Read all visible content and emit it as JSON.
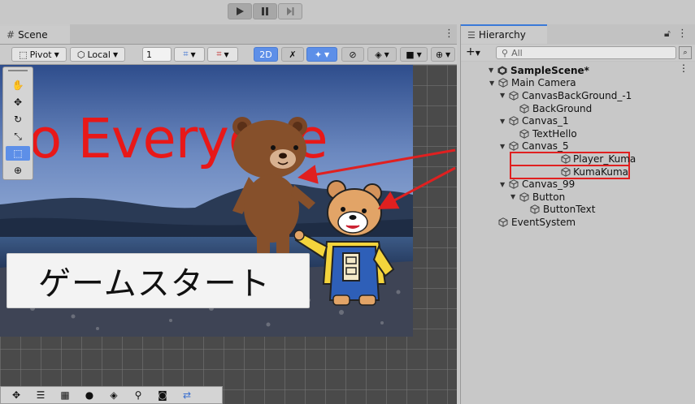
{
  "scene_tab": {
    "label": "Scene"
  },
  "scene_toolbar": {
    "pivot_label": "Pivot",
    "local_label": "Local",
    "grid_value": "1",
    "mode_2d": "2D"
  },
  "viewport": {
    "hello_text": "llo Everyone",
    "start_button_text": "ゲームスタート"
  },
  "hierarchy": {
    "tab_label": "Hierarchy",
    "search_placeholder": "All",
    "items": [
      {
        "label": "SampleScene*",
        "depth": 0,
        "expanded": true,
        "icon": "unity-scene-icon",
        "bold": true
      },
      {
        "label": "Main Camera",
        "depth": 1,
        "expanded": true,
        "icon": "gameobject-icon"
      },
      {
        "label": "CanvasBackGround_-1",
        "depth": 2,
        "expanded": true,
        "icon": "gameobject-icon"
      },
      {
        "label": "BackGround",
        "depth": 3,
        "expanded": false,
        "icon": "gameobject-icon"
      },
      {
        "label": "Canvas_1",
        "depth": 2,
        "expanded": true,
        "icon": "gameobject-icon"
      },
      {
        "label": "TextHello",
        "depth": 3,
        "expanded": false,
        "icon": "gameobject-icon"
      },
      {
        "label": "Canvas_5",
        "depth": 2,
        "expanded": true,
        "icon": "gameobject-icon"
      },
      {
        "label": "Player_Kuma",
        "depth": 3,
        "expanded": false,
        "icon": "gameobject-icon",
        "highlight": true
      },
      {
        "label": "KumaKuma",
        "depth": 3,
        "expanded": false,
        "icon": "gameobject-icon",
        "highlight": true
      },
      {
        "label": "Canvas_99",
        "depth": 2,
        "expanded": true,
        "icon": "gameobject-icon"
      },
      {
        "label": "Button",
        "depth": 3,
        "expanded": true,
        "icon": "gameobject-icon"
      },
      {
        "label": "ButtonText",
        "depth": 4,
        "expanded": false,
        "icon": "gameobject-icon"
      },
      {
        "label": "EventSystem",
        "depth": 1,
        "expanded": false,
        "icon": "gameobject-icon"
      }
    ]
  },
  "colors": {
    "accent": "#5d8fe8",
    "hello_red": "#e81818",
    "highlight_red": "#e02020"
  }
}
